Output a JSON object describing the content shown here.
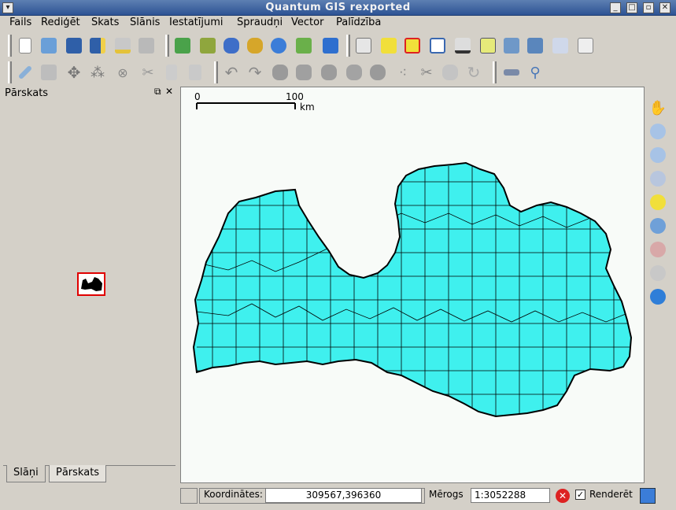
{
  "window": {
    "title": "Quantum GIS rexported"
  },
  "menu": [
    "Fails",
    "Rediģēt",
    "Skats",
    "Slānis",
    "Iestatījumi",
    "Spraudņi",
    "Vector",
    "Palīdzība"
  ],
  "panel": {
    "title": "Pārskats"
  },
  "tabs": {
    "layers": "Slāņi",
    "overview": "Pārskats"
  },
  "scalebar": {
    "start": "0",
    "end": "100",
    "unit": "km"
  },
  "status": {
    "coords_label": "Koordinātes:",
    "coords_value": "309567,396360",
    "scale_label": "Mērogs",
    "scale_value": "1:3052288",
    "render_label": "Renderēt",
    "render_checked": true
  },
  "colors": {
    "map_fill": "#3ff0ee",
    "title_bar": "#2d5394",
    "overview_extent": "#e00000"
  },
  "toolbar_icons": [
    "new-project-icon",
    "open-project-icon",
    "save-project-icon",
    "save-as-icon",
    "print-composer-icon",
    "print-icon",
    "add-vector-layer-icon",
    "add-raster-layer-icon",
    "add-postgis-layer-icon",
    "add-spatialite-layer-icon",
    "add-wms-layer-icon",
    "new-vector-layer-icon",
    "remove-layer-icon",
    "identify-icon",
    "select-icon",
    "deselect-icon",
    "attribute-table-icon",
    "measure-icon",
    "annotation-icon",
    "home-icon",
    "home-alt-icon",
    "label-icon",
    "text-annotation-icon"
  ],
  "edit_toolbar_icons": [
    "toggle-edit-icon",
    "save-edits-icon",
    "move-feature-icon",
    "node-tool-icon",
    "delete-selected-icon",
    "cut-icon",
    "copy-icon",
    "paste-icon",
    "undo-icon",
    "redo-icon",
    "simplify-icon",
    "add-ring-icon",
    "add-part-icon",
    "delete-ring-icon",
    "delete-part-icon",
    "reshape-icon",
    "split-icon",
    "merge-icon",
    "merge-attributes-icon",
    "rotate-icon",
    "gps-icon",
    "zoom-tool-icon"
  ],
  "nav_icons": [
    "pan-icon",
    "zoom-in-icon",
    "zoom-out-icon",
    "zoom-full-icon",
    "zoom-selection-icon",
    "zoom-layer-icon",
    "zoom-last-icon",
    "zoom-next-icon",
    "refresh-icon"
  ]
}
